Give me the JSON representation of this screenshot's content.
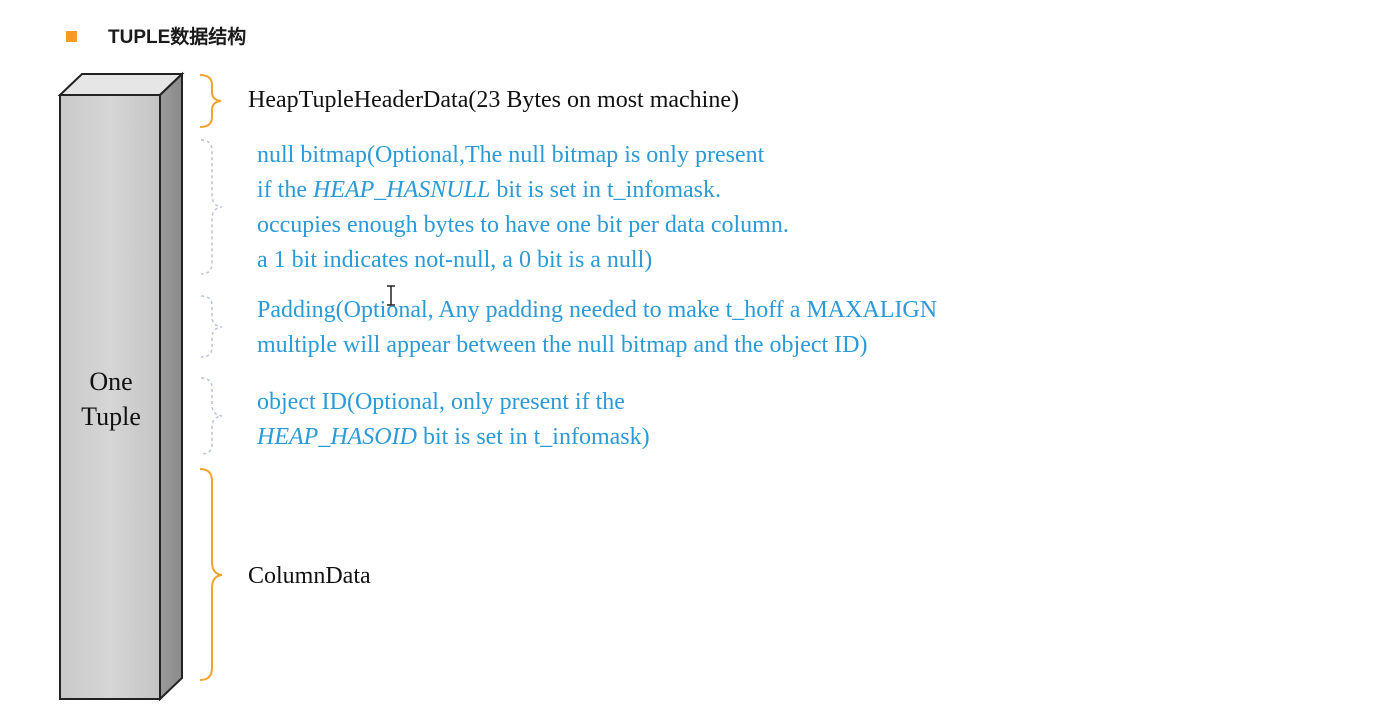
{
  "slide": {
    "title": "TUPLE数据结构",
    "accent_color": "#f59a23",
    "text_blue": "#2b9ad6",
    "brace_solid_color": "#f0a531",
    "brace_dashed_color": "#b8c4d4"
  },
  "tuple": {
    "label_line1": "One",
    "label_line2": "Tuple"
  },
  "sections": {
    "header": {
      "text": "HeapTupleHeaderData(23 Bytes on most machine)"
    },
    "null_bitmap": {
      "line1": "null bitmap(Optional,The null bitmap is only present",
      "line2_pre": "if the ",
      "line2_em": "HEAP_HASNULL",
      "line2_post": " bit is set in t_infomask.",
      "line3": "occupies enough bytes to have one bit per data column.",
      "line4": "a 1 bit indicates not-null, a 0 bit is a null)"
    },
    "padding": {
      "line1": "Padding(Optional, Any padding needed to make t_hoff a MAXALIGN",
      "line2": "multiple will appear between the null bitmap and the object ID)"
    },
    "object_id": {
      "line1": "object ID(Optional, only present if the",
      "line2_em": "HEAP_HASOID",
      "line2_post": " bit is set in t_infomask)"
    },
    "column_data": {
      "text": "ColumnData"
    }
  }
}
